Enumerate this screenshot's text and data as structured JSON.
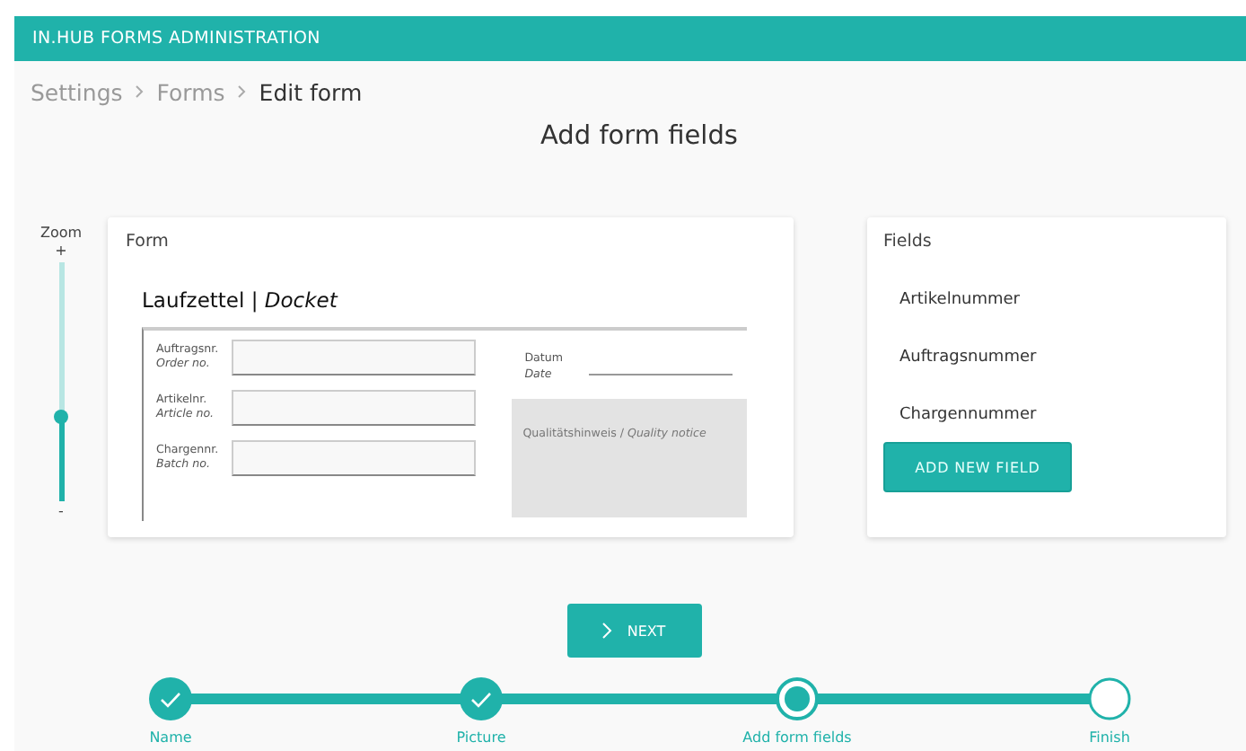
{
  "app_bar": {
    "title": "IN.HUB FORMS ADMINISTRATION"
  },
  "breadcrumb": [
    {
      "label": "Settings",
      "current": false
    },
    {
      "label": "Forms",
      "current": false
    },
    {
      "label": "Edit form",
      "current": true
    }
  ],
  "page_title": "Add form fields",
  "zoom": {
    "label": "Zoom",
    "plus": "+",
    "minus": "-",
    "level": 0.35
  },
  "form_card": {
    "title": "Form",
    "doc_title": "Laufzettel | *Docket*",
    "fields": [
      {
        "label": "Auftragsnr.",
        "label_en": "Order no."
      },
      {
        "label": "Artikelnr.",
        "label_en": "Article no."
      },
      {
        "label": "Chargennr.",
        "label_en": "Batch no."
      }
    ],
    "date": {
      "label": "Datum",
      "label_en": "Date"
    },
    "notice": "Qualitätshinweis / *Quality notice*"
  },
  "fields_card": {
    "title": "Fields",
    "items": [
      "Artikelnummer",
      "Auftragsnummer",
      "Chargennummer"
    ],
    "add_button": "ADD NEW FIELD"
  },
  "next_button": "NEXT",
  "steps": [
    {
      "label": "Name",
      "kind": "done"
    },
    {
      "label": "Picture",
      "kind": "done"
    },
    {
      "label": "Add form fields",
      "kind": "current"
    },
    {
      "label": "Finish",
      "kind": "todo"
    }
  ]
}
